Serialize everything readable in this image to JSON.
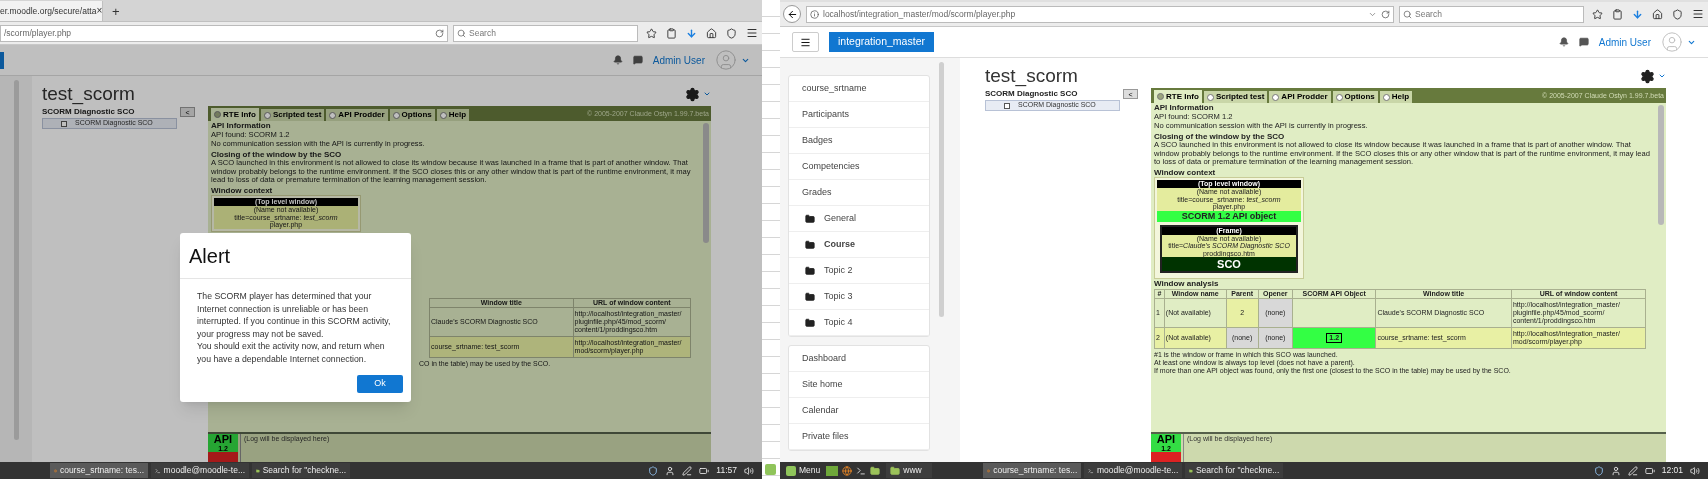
{
  "screens": [
    {
      "browser": {
        "tab": "er.moodle.org/secure/atta",
        "tab_close": "×",
        "new_tab": "+",
        "url": "/scorm/player.php",
        "search_placeholder": "Search"
      },
      "header": {
        "user": "Admin User"
      },
      "page": {
        "title": "test_scorm",
        "toc": {
          "heading": "SCORM Diagnostic SCO",
          "item": "SCORM Diagnostic SCO",
          "collapse": "<"
        },
        "panel": {
          "tabs": [
            {
              "label": "RTE Info",
              "selected": true
            },
            {
              "label": "Scripted test",
              "selected": false
            },
            {
              "label": "API Prodder",
              "selected": false
            },
            {
              "label": "Options",
              "selected": false
            },
            {
              "label": "Help",
              "selected": false
            }
          ],
          "copyright": "© 2005-2007 Claude Ostyn 1.99.7.beta",
          "blocks": [
            {
              "kind": "heading",
              "text": "API Information"
            },
            {
              "kind": "text",
              "text": "API found: SCORM 1.2"
            },
            {
              "kind": "text",
              "text": "No communication session with the API is currently in progress."
            },
            {
              "kind": "heading",
              "text": "Closing of the window by the SCO"
            },
            {
              "kind": "text",
              "text": "A SCO launched in this environment is not allowed to close its window because it was launched in a frame that is part of another window. That window probably belongs to the runtime environment. If the SCO closes this or any other window that is part of the runtime environment, it may lead to loss of data or premature termination of the learning management session."
            },
            {
              "kind": "heading",
              "text": "Window context"
            },
            {
              "kind": "context",
              "top": {
                "header": "(Top level window)",
                "lines": [
                  "(Name not available)",
                  "title=course_srtname: *test_scorm*",
                  "player.php"
                ]
              }
            },
            {
              "kind": "table",
              "columns": [
                "Window title",
                "URL of window content"
              ],
              "rows": [
                {
                  "cells": [
                    {
                      "kind": "plain",
                      "text": "Claude's SCORM Diagnostic SCO"
                    },
                    {
                      "kind": "plain",
                      "text": "http://localhost/integration_master/\npluginfile.php/45/mod_scorm/\ncontent/1/proddingsco.htm"
                    }
                  ]
                },
                {
                  "cells": [
                    {
                      "kind": "top",
                      "text": "course_srtname: test_scorm"
                    },
                    {
                      "kind": "top",
                      "text": "http://localhost/integration_master/\nmod/scorm/player.php"
                    }
                  ]
                }
              ]
            },
            {
              "kind": "notes",
              "lines": [
                "CO in the table) may be used by the SCO."
              ]
            }
          ],
          "log": {
            "placeholder": "(Log will be displayed here)",
            "api": "API",
            "version": "1.2"
          }
        }
      },
      "alert": {
        "title": "Alert",
        "lines": [
          "The SCORM player has determined that your Internet connection is unreliable or has been interrupted. If you continue in this SCORM activity, your progress may not be saved.",
          "You should exit the activity now, and return when you have a dependable Internet connection."
        ],
        "button": "Ok"
      },
      "taskbar": {
        "items": [
          {
            "label": "course_srtname: tes...",
            "kind": "browser",
            "selected": true
          },
          {
            "label": "moodle@moodle-te...",
            "kind": "terminal",
            "selected": false
          },
          {
            "label": "Search for \"checkne...",
            "kind": "folder",
            "selected": false
          }
        ],
        "clock": "11:57"
      }
    },
    {
      "browser": {
        "url": "localhost/integration_master/mod/scorm/player.php",
        "search_placeholder": "Search"
      },
      "header": {
        "brand": "integration_master",
        "user": "Admin User"
      },
      "sidebar": {
        "blocks": [
          {
            "items": [
              {
                "label": "course_srtname",
                "kind": "link",
                "selected": false
              },
              {
                "label": "Participants",
                "kind": "link",
                "selected": false
              },
              {
                "label": "Badges",
                "kind": "link",
                "selected": false
              },
              {
                "label": "Competencies",
                "kind": "link",
                "selected": false
              },
              {
                "label": "Grades",
                "kind": "link",
                "selected": false
              },
              {
                "label": "General",
                "kind": "section",
                "selected": false
              },
              {
                "label": "Course",
                "kind": "section",
                "selected": true
              },
              {
                "label": "Topic 2",
                "kind": "section",
                "selected": false
              },
              {
                "label": "Topic 3",
                "kind": "section",
                "selected": false
              },
              {
                "label": "Topic 4",
                "kind": "section",
                "selected": false
              }
            ]
          },
          {
            "items": [
              {
                "label": "Dashboard",
                "kind": "link",
                "selected": false
              },
              {
                "label": "Site home",
                "kind": "link",
                "selected": false
              },
              {
                "label": "Calendar",
                "kind": "link",
                "selected": false
              },
              {
                "label": "Private files",
                "kind": "link",
                "selected": false
              }
            ]
          }
        ]
      },
      "page": {
        "title": "test_scorm",
        "toc": {
          "heading": "SCORM Diagnostic SCO",
          "item": "SCORM Diagnostic SCO",
          "collapse": "<"
        },
        "panel": {
          "tabs": [
            {
              "label": "RTE Info",
              "selected": true
            },
            {
              "label": "Scripted test",
              "selected": false
            },
            {
              "label": "API Prodder",
              "selected": false
            },
            {
              "label": "Options",
              "selected": false
            },
            {
              "label": "Help",
              "selected": false
            }
          ],
          "copyright": "© 2005-2007 Claude Ostyn 1.99.7.beta",
          "blocks": [
            {
              "kind": "heading",
              "text": "API Information"
            },
            {
              "kind": "text",
              "text": "API found: SCORM 1.2"
            },
            {
              "kind": "text",
              "text": "No communication session with the API is currently in progress."
            },
            {
              "kind": "heading",
              "text": "Closing of the window by the SCO"
            },
            {
              "kind": "text",
              "text": "A SCO launched in this environment is not allowed to close its window because it was launched in a frame that is part of another window. That window probably belongs to the runtime environment. If the SCO closes this or any other window that is part of the runtime environment, it may lead to loss of data or premature termination of the learning management session."
            },
            {
              "kind": "heading",
              "text": "Window context"
            },
            {
              "kind": "context",
              "top": {
                "header": "(Top level window)",
                "lines": [
                  "(Name not available)",
                  "title=course_srtname: *test_scorm*",
                  "player.php"
                ],
                "api": "SCORM 1.2 API object"
              },
              "frame": {
                "header": "(Frame)",
                "lines": [
                  "(Name not available)",
                  "title=*Claude's SCORM Diagnostic SCO*",
                  "proddingsco.htm"
                ],
                "label": "SCO"
              }
            },
            {
              "kind": "heading",
              "text": "Window analysis"
            },
            {
              "kind": "table",
              "columns": [
                "#",
                "Window name",
                "Parent",
                "Opener",
                "SCORM API Object",
                "Window title",
                "URL of window content"
              ],
              "rows": [
                {
                  "cells": [
                    {
                      "kind": "plain",
                      "text": "1"
                    },
                    {
                      "kind": "plain",
                      "text": "(Not available)"
                    },
                    {
                      "kind": "ref",
                      "text": "2"
                    },
                    {
                      "kind": "none",
                      "text": "(none)"
                    },
                    {
                      "kind": "empty"
                    },
                    {
                      "kind": "plain",
                      "text": "Claude's SCORM Diagnostic SCO"
                    },
                    {
                      "kind": "plain",
                      "text": "http://localhost/integration_master/\npluginfile.php/45/mod_scorm/\ncontent/1/proddingsco.htm"
                    }
                  ]
                },
                {
                  "cells": [
                    {
                      "kind": "top",
                      "text": "2"
                    },
                    {
                      "kind": "top",
                      "text": "(Not available)"
                    },
                    {
                      "kind": "none",
                      "text": "(none)"
                    },
                    {
                      "kind": "none",
                      "text": "(none)"
                    },
                    {
                      "kind": "api",
                      "text": "1.2"
                    },
                    {
                      "kind": "top",
                      "text": "course_srtname: test_scorm"
                    },
                    {
                      "kind": "top",
                      "text": "http://localhost/integration_master/\nmod/scorm/player.php"
                    }
                  ]
                }
              ]
            },
            {
              "kind": "notes",
              "lines": [
                "#1 is the window or frame in which this SCO was launched.",
                "At least one window is always top level (does not have a parent).",
                "If more than one API object was found, only the first one (closest to the SCO in the table) may be used by the SCO."
              ]
            }
          ],
          "log": {
            "placeholder": "(Log will be displayed here)",
            "api": "API",
            "version": "1.2"
          }
        }
      },
      "taskbar": {
        "menu": "Menu",
        "items": [
          {
            "label": "www",
            "kind": "folder",
            "selected": false
          },
          {
            "label": "course_srtname: tes...",
            "kind": "browser",
            "selected": true
          },
          {
            "label": "moodle@moodle-te...",
            "kind": "terminal",
            "selected": false
          },
          {
            "label": "Search for \"checkne...",
            "kind": "folder",
            "selected": false
          }
        ],
        "clock": "12:01"
      }
    }
  ]
}
